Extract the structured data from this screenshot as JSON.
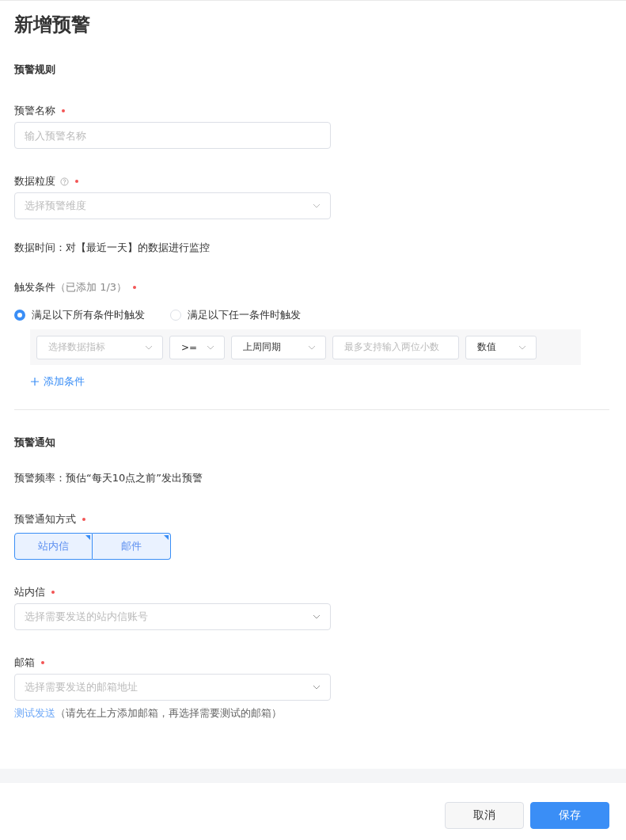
{
  "title": "新增预警",
  "rules": {
    "heading": "预警规则",
    "name_field": {
      "label": "预警名称",
      "required": true,
      "placeholder": "输入预警名称"
    },
    "granularity_field": {
      "label": "数据粒度",
      "required": true,
      "placeholder": "选择预警维度"
    },
    "data_time": "数据时间：对【最近一天】的数据进行监控",
    "trigger": {
      "label": "触发条件",
      "count_note": "（已添加 1/3）",
      "required": true,
      "modes": [
        {
          "label": "满足以下所有条件时触发",
          "selected": true
        },
        {
          "label": "满足以下任一条件时触发",
          "selected": false
        }
      ],
      "conditions": [
        [
          {
            "kind": "select",
            "placeholder": "选择数据指标"
          },
          {
            "kind": "select",
            "value": ">="
          },
          {
            "kind": "select",
            "value": "上周同期"
          },
          {
            "kind": "input",
            "placeholder": "最多支持输入两位小数"
          },
          {
            "kind": "select",
            "value": "数值"
          }
        ]
      ],
      "add_label": "添加条件"
    }
  },
  "notify": {
    "heading": "预警通知",
    "frequency": "预警频率：预估“每天10点之前”发出预警",
    "methods": {
      "label": "预警通知方式",
      "required": true,
      "options": [
        {
          "label": "站内信",
          "selected": true
        },
        {
          "label": "邮件",
          "selected": true
        }
      ]
    },
    "inbox_field": {
      "label": "站内信",
      "required": true,
      "placeholder": "选择需要发送的站内信账号"
    },
    "email_field": {
      "label": "邮箱",
      "required": true,
      "placeholder": "选择需要发送的邮箱地址"
    },
    "test_link": "测试发送",
    "test_note": "（请先在上方添加邮箱，再选择需要测试的邮箱）"
  },
  "buttons": [
    {
      "label": "取消",
      "kind": "secondary"
    },
    {
      "label": "保存",
      "kind": "primary"
    }
  ]
}
